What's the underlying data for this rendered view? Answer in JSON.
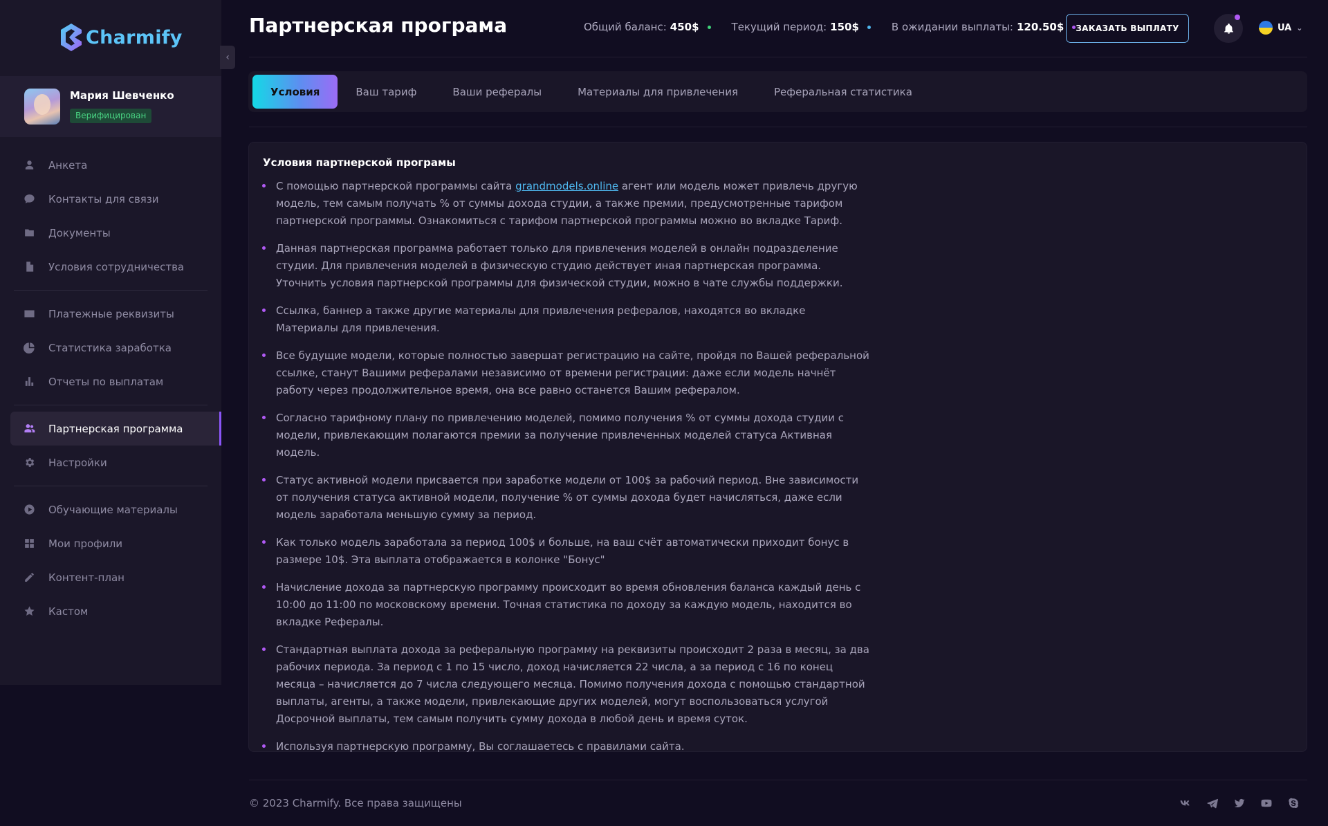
{
  "app": {
    "logo_text": "Charmify",
    "accent_color": "#8a55f7",
    "link_color": "#4fb8f0"
  },
  "user": {
    "name": "Мария Шевченко",
    "status": "Верифицирован"
  },
  "sidebar": {
    "groups": [
      [
        {
          "label": "Анкета",
          "icon": "user-icon"
        },
        {
          "label": "Контакты для связи",
          "icon": "chat-icon"
        },
        {
          "label": "Документы",
          "icon": "folder-icon"
        },
        {
          "label": "Условия сотрудничества",
          "icon": "file-icon"
        }
      ],
      [
        {
          "label": "Платежные реквизиты",
          "icon": "card-icon"
        },
        {
          "label": "Статистика заработка",
          "icon": "pie-chart-icon"
        },
        {
          "label": "Отчеты по выплатам",
          "icon": "bar-chart-icon"
        }
      ],
      [
        {
          "label": "Партнерская программа",
          "icon": "users-icon",
          "active": true
        },
        {
          "label": "Настройки",
          "icon": "gear-icon"
        }
      ],
      [
        {
          "label": "Обучающие материалы",
          "icon": "play-icon"
        },
        {
          "label": "Мои профили",
          "icon": "grid-icon"
        },
        {
          "label": "Контент-план",
          "icon": "pencil-icon"
        },
        {
          "label": "Кастом",
          "icon": "star-icon"
        }
      ]
    ]
  },
  "header": {
    "title": "Партнерская програма",
    "stats": [
      {
        "label": "Общий баланс:",
        "value": "450$",
        "color": "#3ed37a"
      },
      {
        "label": "Текущий период:",
        "value": "150$",
        "color": "#4fb8f0"
      },
      {
        "label": "В ожидании выплаты:",
        "value": "120.50$",
        "color": "#b15af5"
      }
    ],
    "order_button": "ЗАКАЗАТЬ ВЫПЛАТУ",
    "language": "UA"
  },
  "tabs": [
    {
      "label": "Условия",
      "active": true
    },
    {
      "label": "Ваш тариф"
    },
    {
      "label": "Ваши рефералы"
    },
    {
      "label": "Материалы для привлечения"
    },
    {
      "label": "Реферальная статистика"
    }
  ],
  "terms": {
    "title": "Условия партнерской програмы",
    "link_text": "grandmodels.online",
    "first_prefix": "С помощью партнерской программы сайта ",
    "first_suffix": " агент или модель может привлечь другую модель, тем самым получать % от суммы дохода студии, а также премии, предусмотренные тарифом партнерской программы. Ознакомиться с тарифом партнерской программы можно во вкладке Тариф.",
    "items": [
      "Данная партнерская программа работает только для привлечения моделей в онлайн подразделение студии. Для привлечения моделей в физическую студию действует иная партнерская программа. Уточнить условия партнерской программы для физической студии, можно в чате службы поддержки.",
      "Ссылка, баннер а также другие материалы для привлечения рефералов, находятся во вкладке Материалы для привлечения.",
      "Все будущие модели, которые полностью завершат регистрацию на сайте, пройдя по Вашей реферальной ссылке, станут Вашими рефералами независимо от времени регистрации: даже если модель начнёт работу через продолжительное время, она все равно останется Вашим рефералом.",
      "Согласно тарифному плану по привлечению моделей, помимо получения % от суммы дохода студии с модели, привлекающим полагаются премии за получение привлеченных моделей статуса Активная модель.",
      "Статус активной модели присвается при заработке модели от 100$ за рабочий период. Вне зависимости от получения статуса активной модели, получение % от суммы дохода будет начисляться, даже если модель заработала меньшую сумму за период.",
      "Как только модель заработала за период 100$ и больше, на ваш счёт автоматически приходит бонус в размере 10$. Эта выплата отображается в колонке \"Бонус\"",
      "Начисление дохода за партнерскую программу происходит во время обновления баланса каждый день с 10:00 до 11:00 по московскому времени. Точная статистика по доходу за каждую модель, находится во вкладке Рефералы.",
      "Стандартная выплата дохода за реферальную программу на реквизиты происходит 2 раза в месяц, за два рабочих периода. За период с 1 по 15 число, доход начисляется 22 числа, а за период с 16 по конец месяца – начисляется до 7 числа следующего месяца. Помимо получения дохода с помощью стандартной выплаты, агенты, а также модели, привлекающие других моделей, могут воспользоваться услугой Досрочной выплаты, тем самым получить сумму дохода в любой день и время суток.",
      "Используя партнерскую программу, Вы соглашаетесь с правилами сайта."
    ]
  },
  "footer": {
    "copyright": "© 2023 Charmify. Все права защищены",
    "socials": [
      "vk-icon",
      "telegram-icon",
      "twitter-icon",
      "youtube-icon",
      "skype-icon"
    ]
  }
}
